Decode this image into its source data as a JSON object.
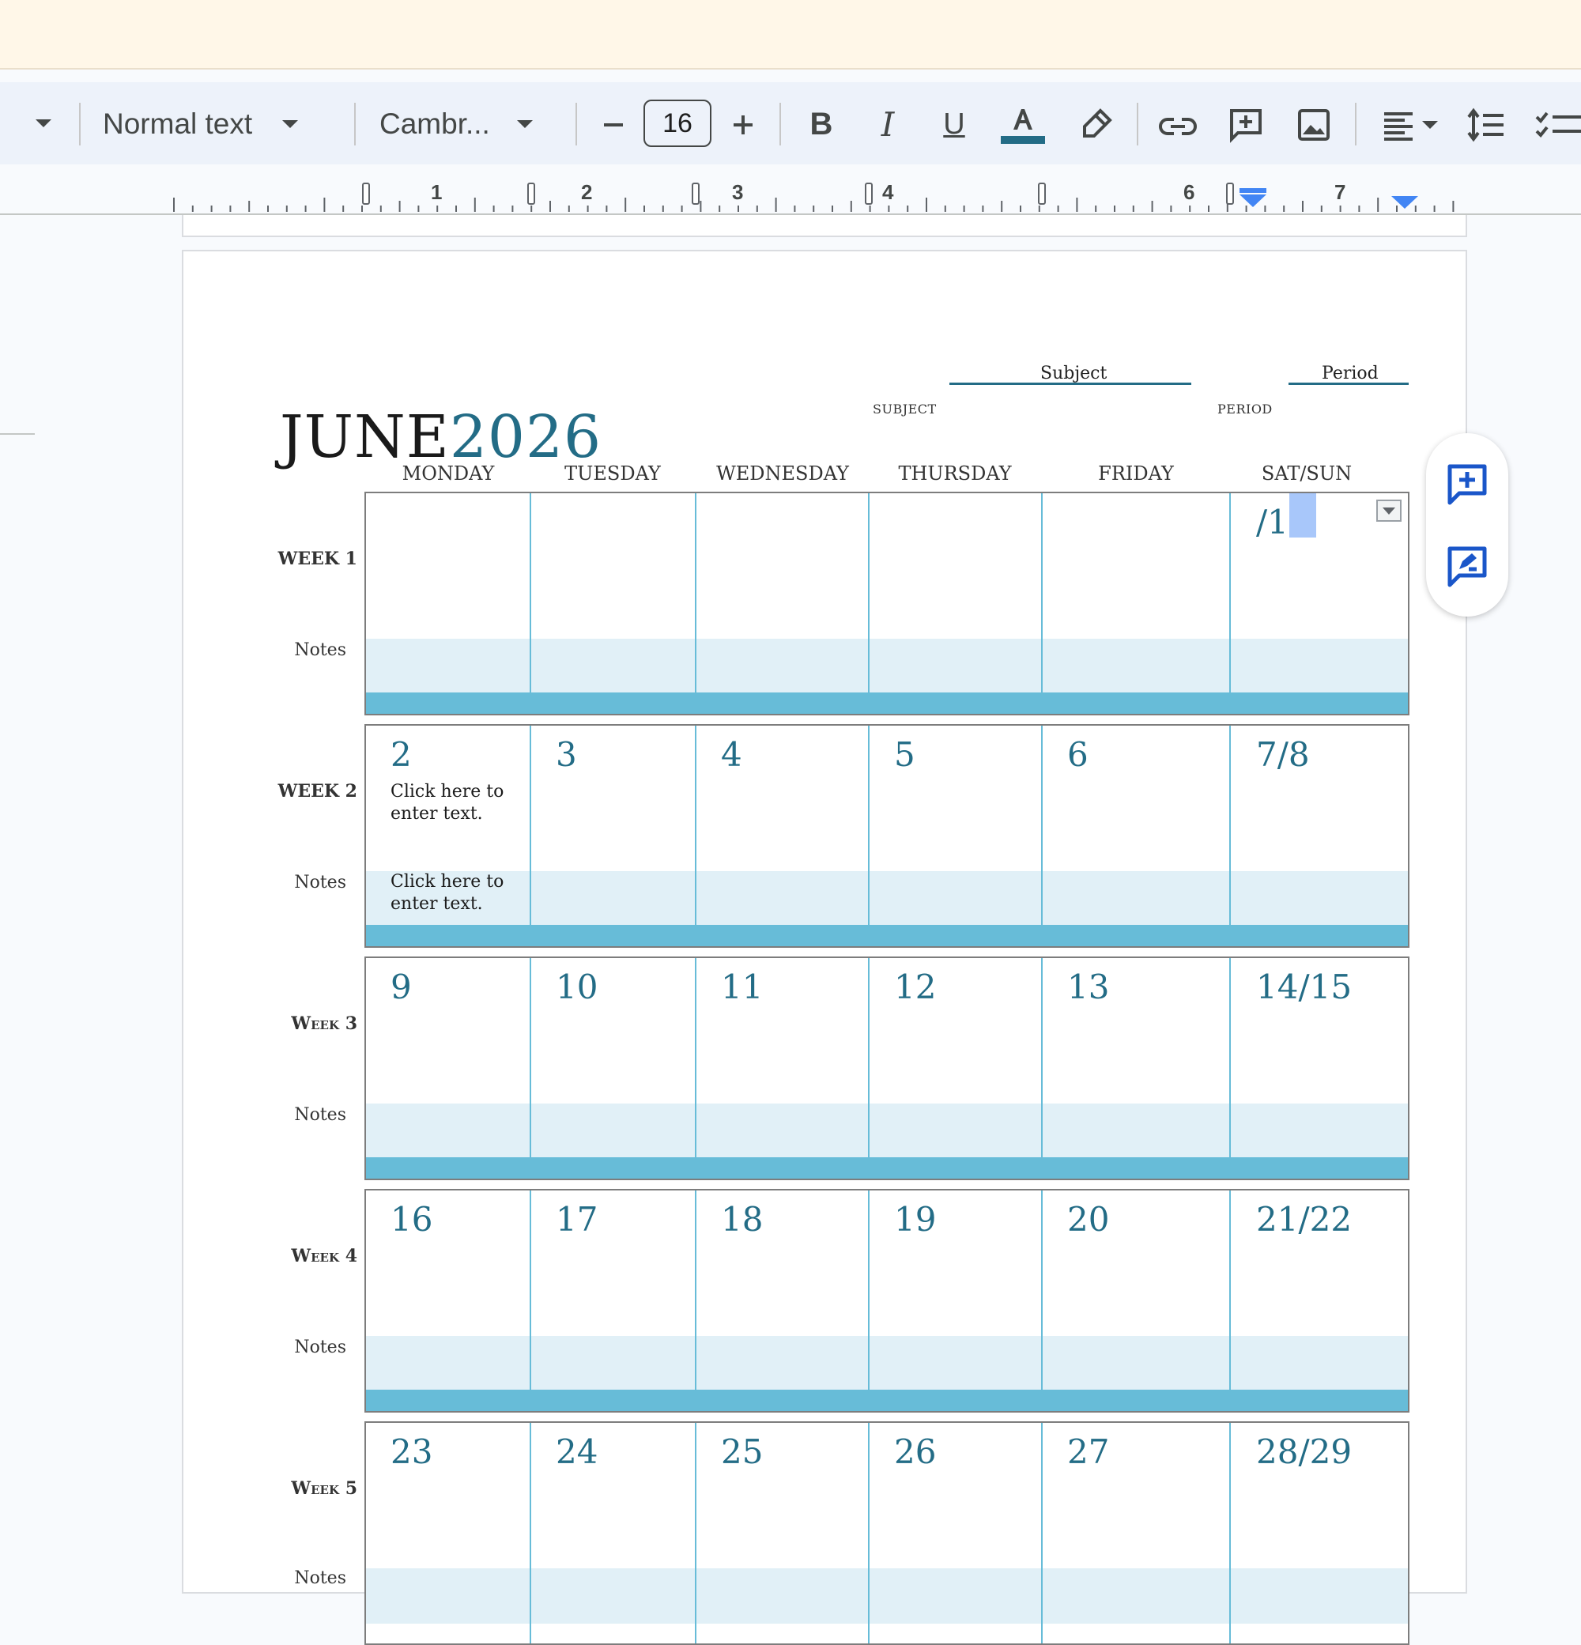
{
  "toolbar": {
    "style_select": "Normal text",
    "font_select": "Cambr...",
    "font_size": "16",
    "icons": [
      "caret-down-icon",
      "decrease-font-size-icon",
      "increase-font-size-icon",
      "bold-icon",
      "italic-icon",
      "underline-icon",
      "text-color-icon",
      "highlight-icon",
      "link-icon",
      "add-comment-icon",
      "image-icon",
      "align-icon",
      "line-spacing-icon",
      "checklist-icon"
    ],
    "text_color": "#236c86"
  },
  "ruler": {
    "numbers": [
      "1",
      "2",
      "3",
      "4",
      "6",
      "7"
    ]
  },
  "document": {
    "title_month": "JUNE",
    "title_year": "2026",
    "subject_value": "Subject",
    "subject_caption": "SUBJECT",
    "period_value": "Period",
    "period_caption": "PERIOD",
    "days": [
      "MONDAY",
      "TUESDAY",
      "WEDNESDAY",
      "THURSDAY",
      "FRIDAY",
      "SAT/SUN"
    ],
    "notes_label": "Notes",
    "weeks": [
      {
        "label": "WEEK 1",
        "dates": [
          "",
          "",
          "",
          "",
          "",
          "/1"
        ]
      },
      {
        "label": "WEEK 2",
        "dates": [
          "2",
          "3",
          "4",
          "5",
          "6",
          "7/8"
        ],
        "placeholder": "Click here to enter text.",
        "notes_placeholder": "Click here to enter text."
      },
      {
        "label": "Week 3",
        "dates": [
          "9",
          "10",
          "11",
          "12",
          "13",
          "14/15"
        ]
      },
      {
        "label": "Week 4",
        "dates": [
          "16",
          "17",
          "18",
          "19",
          "20",
          "21/22"
        ]
      },
      {
        "label": "Week 5",
        "dates": [
          "23",
          "24",
          "25",
          "26",
          "27",
          "28/29"
        ]
      }
    ]
  },
  "side_panel": {
    "icons": [
      "add-comment-icon",
      "suggest-edit-icon"
    ]
  },
  "colors": {
    "accent": "#236c86",
    "band": "#67bcd8",
    "notes_band": "#e1f0f7"
  }
}
